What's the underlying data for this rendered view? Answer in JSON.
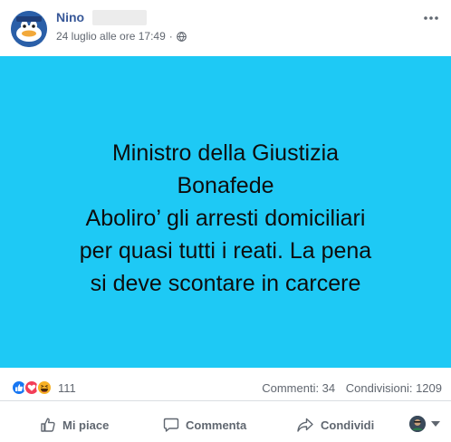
{
  "post": {
    "author_name": "Nino",
    "timestamp": "24 luglio alle ore 17:49",
    "separator": "·",
    "privacy_icon": "globe-icon",
    "more_icon": "ellipsis-icon"
  },
  "content": {
    "background": "#1ec9f5",
    "lines": [
      "Ministro della Giustizia",
      "Bonafede",
      "Aboliro’ gli arresti domiciliari",
      "per quasi tutti i reati. La pena",
      "si deve scontare in carcere"
    ]
  },
  "stats": {
    "reactions": [
      "like-reaction-icon",
      "love-reaction-icon",
      "haha-reaction-icon"
    ],
    "reaction_count": "111",
    "comments": "Commenti: 34",
    "shares": "Condivisioni: 1209"
  },
  "actions": {
    "like_label": "Mi piace",
    "comment_label": "Commenta",
    "share_label": "Condividi"
  },
  "colors": {
    "link": "#385898",
    "like_blue": "#1877f2",
    "love_red": "#f33e58",
    "haha_yellow": "#f7b125"
  }
}
